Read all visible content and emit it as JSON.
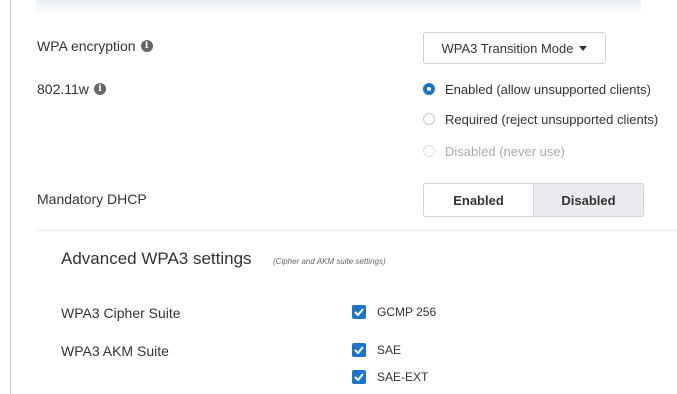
{
  "wpa_encryption": {
    "label": "WPA encryption",
    "selected": "WPA3 Transition Mode"
  },
  "dot11w": {
    "label": "802.11w",
    "options": [
      {
        "label": "Enabled (allow unsupported clients)",
        "state": "selected"
      },
      {
        "label": "Required (reject unsupported clients)",
        "state": "unselected"
      },
      {
        "label": "Disabled (never use)",
        "state": "disabled"
      }
    ]
  },
  "mandatory_dhcp": {
    "label": "Mandatory DHCP",
    "options": [
      "Enabled",
      "Disabled"
    ],
    "selected": "Disabled"
  },
  "advanced": {
    "title": "Advanced WPA3 settings",
    "subtitle": "(Cipher and AKM suite settings)",
    "cipher_suite": {
      "label": "WPA3 Cipher Suite",
      "options": [
        {
          "label": "GCMP 256",
          "checked": true
        }
      ]
    },
    "akm_suite": {
      "label": "WPA3 AKM Suite",
      "options": [
        {
          "label": "SAE",
          "checked": true
        },
        {
          "label": "SAE-EXT",
          "checked": true
        }
      ]
    }
  },
  "icons": {
    "info": "info-icon",
    "dropdown": "chevron-down-icon",
    "check": "checkmark-icon"
  },
  "colors": {
    "accent": "#1b75c9",
    "active_toggle_bg": "#e9ebee",
    "disabled_text": "#a7acb1"
  }
}
